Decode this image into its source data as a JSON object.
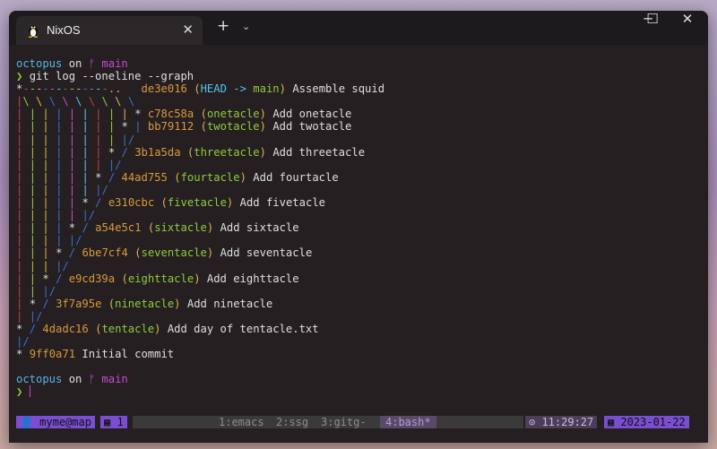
{
  "window": {
    "tab_title": "NixOS",
    "close_label": "✕",
    "new_tab": "+",
    "dropdown": "⌄",
    "minimize": "─",
    "maximize": "☐",
    "close": "✕"
  },
  "prompt1": {
    "user": "octopus",
    "on": " on ",
    "branch_icon": "ᚠ",
    "branch": "main",
    "arrow": "❯",
    "command": "git log --oneline --graph"
  },
  "graph": [
    {
      "graph": "",
      "hash": "de3e016",
      "refs": [
        "HEAD",
        "main"
      ],
      "message": "Assemble squid"
    },
    {
      "hash": "c78c58a",
      "refs": [
        "onetacle"
      ],
      "message": "Add onetacle"
    },
    {
      "hash": "bb79112",
      "refs": [
        "twotacle"
      ],
      "message": "Add twotacle"
    },
    {
      "hash": "3b1a5da",
      "refs": [
        "threetacle"
      ],
      "message": "Add threetacle"
    },
    {
      "hash": "44ad755",
      "refs": [
        "fourtacle"
      ],
      "message": "Add fourtacle"
    },
    {
      "hash": "e310cbc",
      "refs": [
        "fivetacle"
      ],
      "message": "Add fivetacle"
    },
    {
      "hash": "a54e5c1",
      "refs": [
        "sixtacle"
      ],
      "message": "Add sixtacle"
    },
    {
      "hash": "6be7cf4",
      "refs": [
        "seventacle"
      ],
      "message": "Add seventacle"
    },
    {
      "hash": "e9cd39a",
      "refs": [
        "eighttacle"
      ],
      "message": "Add eighttacle"
    },
    {
      "hash": "3f7a95e",
      "refs": [
        "ninetacle"
      ],
      "message": "Add ninetacle"
    },
    {
      "hash": "4dadc16",
      "refs": [
        "tentacle"
      ],
      "message": "Add day of tentacle.txt"
    },
    {
      "hash": "9ff0a71",
      "refs": [],
      "message": "Initial commit"
    }
  ],
  "prompt2": {
    "user": "octopus",
    "on": " on ",
    "branch_icon": "ᚠ",
    "branch": "main",
    "arrow": "❯"
  },
  "status": {
    "session": "👤 myme@map",
    "window_num": "▦ 1",
    "windows": [
      "1:emacs",
      "2:ssg",
      "3:gitg-",
      "4:bash*"
    ],
    "time": "⊙ 11:29:27",
    "date": "▦ 2023-01-22"
  }
}
